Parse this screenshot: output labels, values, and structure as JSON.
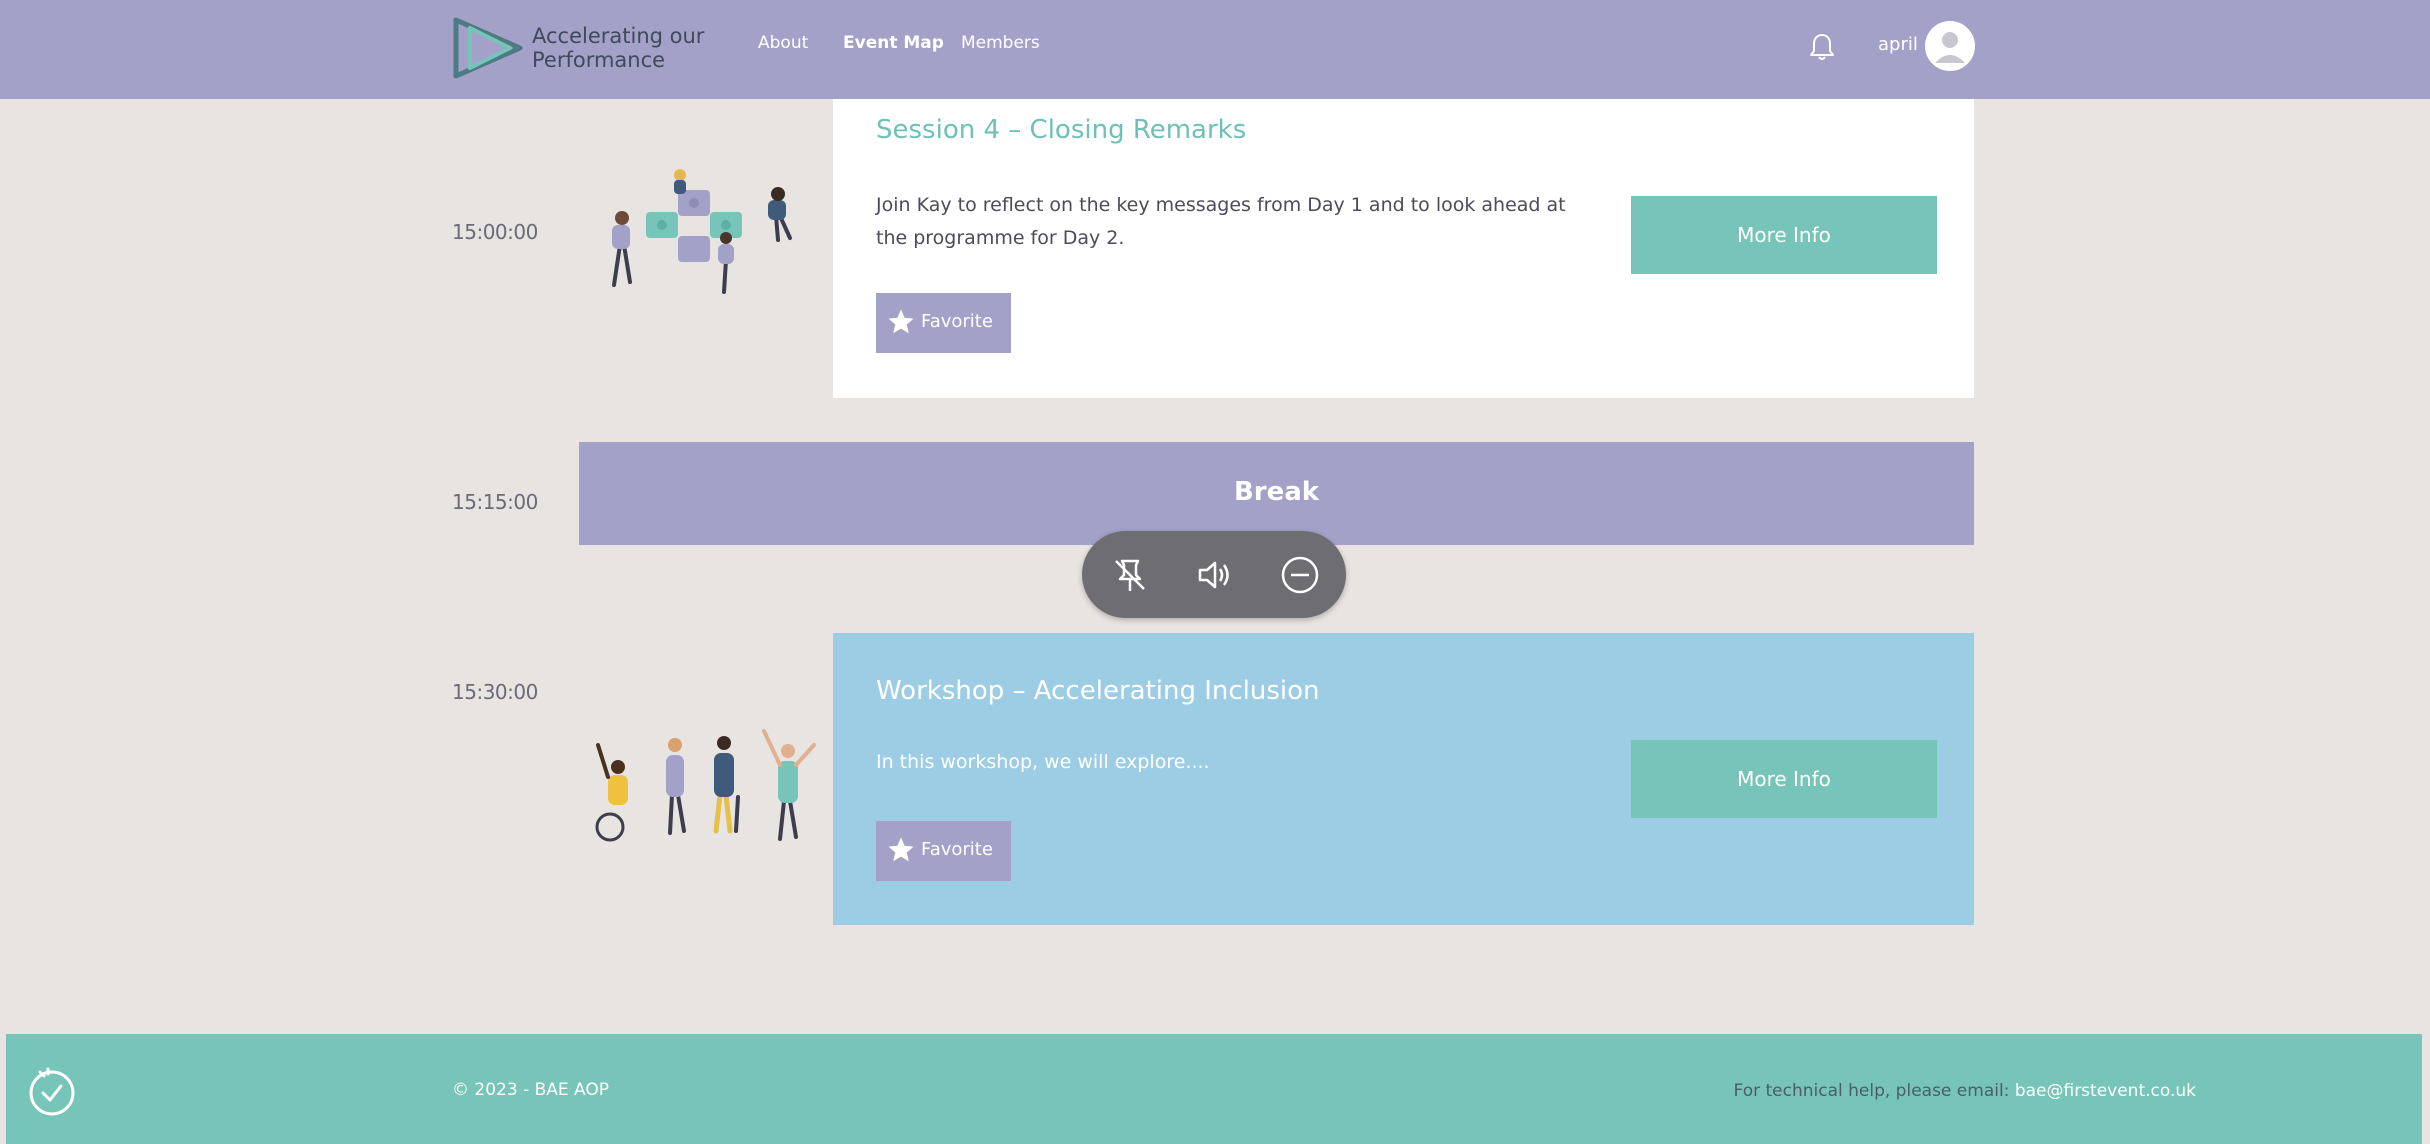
{
  "header": {
    "logo_line1": "Accelerating our",
    "logo_line2": "Performance",
    "nav": [
      {
        "label": "About"
      },
      {
        "label": "Event Map",
        "active": true
      },
      {
        "label": "Members"
      }
    ],
    "username": "april",
    "icons": {
      "notifications": "bell-icon",
      "avatar": "user-avatar-icon"
    }
  },
  "agenda": {
    "sessions": [
      {
        "time": "15:00:00",
        "title": "Session 4 – Closing Remarks",
        "description": "Join Kay to reflect on the key messages from Day 1 and to look ahead at the programme for Day 2.",
        "favorite_label": "Favorite",
        "more_info_label": "More Info",
        "card_color": "#ffffff",
        "illustration": "puzzle-people-illustration"
      },
      {
        "time": "15:15:00",
        "break_label": "Break",
        "card_color": "#a4a1c9"
      },
      {
        "time": "15:30:00",
        "title": "Workshop – Accelerating Inclusion",
        "description": "In this workshop, we will explore....",
        "favorite_label": "Favorite",
        "more_info_label": "More Info",
        "card_color": "#9dcde4",
        "illustration": "diverse-group-celebrating-illustration"
      }
    ]
  },
  "media_controls": {
    "icons": [
      "unpin-icon",
      "volume-icon",
      "minimize-icon"
    ]
  },
  "footer": {
    "copyright": "© 2023 - BAE AOP",
    "help_prefix": "For technical help, please email: ",
    "help_email": "bae@firstevent.co.uk",
    "badge_icon": "checkmark-badge-icon"
  },
  "colors": {
    "header_bg": "#a4a1c9",
    "teal": "#77c4b8",
    "title_teal": "#6fc0b7",
    "blue_card": "#9dcde4",
    "page_bg": "#e7e4e1"
  }
}
